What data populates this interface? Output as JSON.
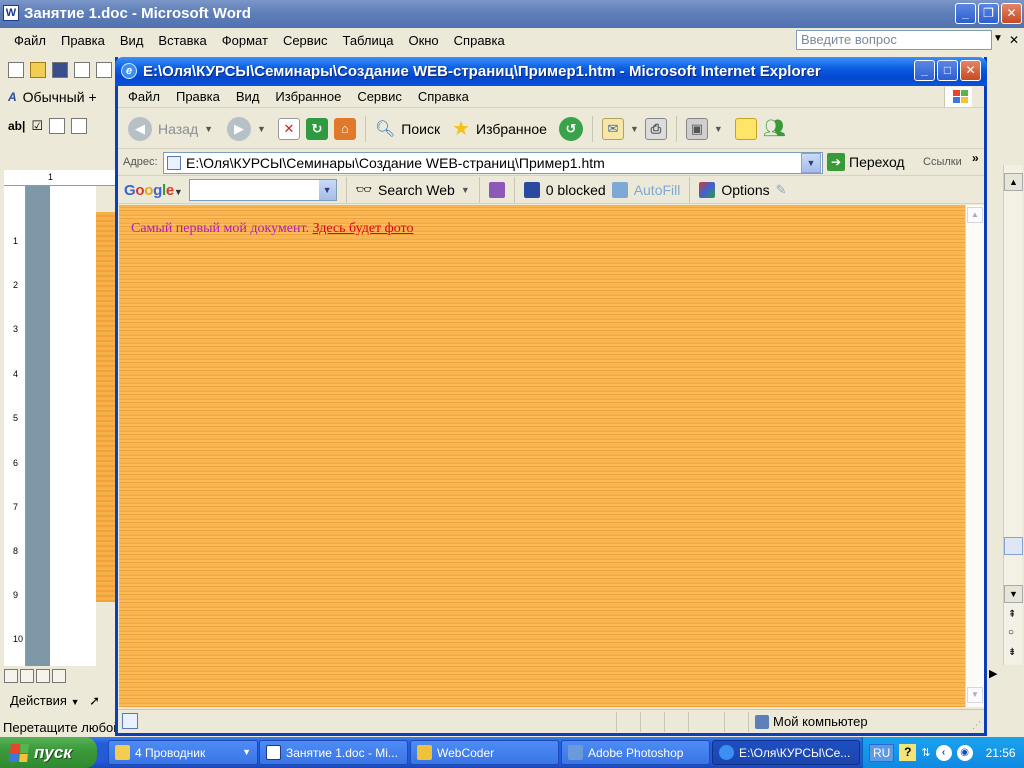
{
  "word": {
    "title": "Занятие 1.doc - Microsoft Word",
    "menu": [
      "Файл",
      "Правка",
      "Вид",
      "Вставка",
      "Формат",
      "Сервис",
      "Таблица",
      "Окно",
      "Справка"
    ],
    "help_placeholder": "Введите вопрос",
    "style_box": "Обычный +",
    "draw_menu": "Действия",
    "status": "Перетащите любой",
    "ruler_top": "1",
    "ruler_marks": [
      "1",
      "2",
      "3",
      "4",
      "5",
      "6",
      "7",
      "8",
      "9",
      "10"
    ]
  },
  "ie": {
    "title": "E:\\Оля\\КУРСЫ\\Семинары\\Создание WEB-страниц\\Пример1.htm - Microsoft Internet Explorer",
    "menu": [
      "Файл",
      "Правка",
      "Вид",
      "Избранное",
      "Сервис",
      "Справка"
    ],
    "toolbar": {
      "back": "Назад",
      "search": "Поиск",
      "favorites": "Избранное"
    },
    "address": {
      "label": "Адрес:",
      "value": "E:\\Оля\\КУРСЫ\\Семинары\\Создание WEB-страниц\\Пример1.htm",
      "go": "Переход",
      "links": "Ссылки"
    },
    "google": {
      "search_web": "Search Web",
      "blocked": "0 blocked",
      "autofill": "AutoFill",
      "options": "Options"
    },
    "page": {
      "text": "Самый первый мой документ.",
      "link": "Здесь будет фото"
    },
    "status": {
      "zone": "Мой компьютер"
    }
  },
  "taskbar": {
    "start": "пуск",
    "tasks": [
      "4 Проводник",
      "Занятие 1.doc - Mi...",
      "WebCoder",
      "Adobe Photoshop",
      "E:\\Оля\\КУРСЫ\\Се..."
    ],
    "lang": "RU",
    "clock": "21:56"
  },
  "colors": {
    "xp_blue": "#0a5ee3",
    "page_text": "#b01dba",
    "page_link": "#e0001f",
    "page_bg": "#f7b451"
  }
}
